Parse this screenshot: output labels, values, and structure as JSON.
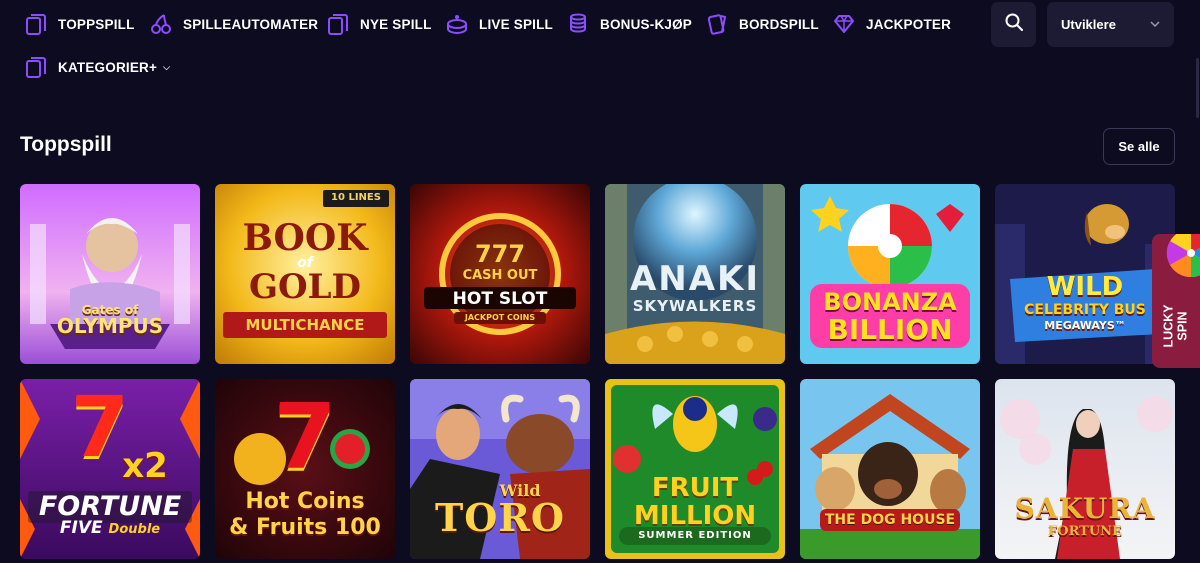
{
  "nav": {
    "items": [
      {
        "label": "TOPPSPILL",
        "icon": "cards-icon"
      },
      {
        "label": "SPILLEAUTOMATER",
        "icon": "cherries-icon"
      },
      {
        "label": "NYE SPILL",
        "icon": "cards-icon"
      },
      {
        "label": "LIVE SPILL",
        "icon": "live-table-icon"
      },
      {
        "label": "BONUS-KJØP",
        "icon": "coins-icon"
      },
      {
        "label": "BORDSPILL",
        "icon": "card-fan-icon"
      },
      {
        "label": "JACKPOTER",
        "icon": "diamond-icon"
      },
      {
        "label": "KATEGORIER+",
        "icon": "cards-icon"
      }
    ],
    "search_icon": "search-icon",
    "provider_select": "Utviklere",
    "accent": "#7b3ff2"
  },
  "section": {
    "title": "Toppspill",
    "see_all": "Se alle"
  },
  "games": [
    {
      "title": "Gates of Olympus",
      "art": [
        "Gates of",
        "OLYMPUS"
      ]
    },
    {
      "title": "Book of Gold Multichance",
      "art": [
        "10 LINES",
        "BOOK",
        "of",
        "GOLD",
        "MULTICHANCE"
      ]
    },
    {
      "title": "777 Cash Out Hot Slot",
      "art": [
        "777",
        "CASH OUT",
        "HOT SLOT",
        "JACKPOT COINS"
      ]
    },
    {
      "title": "Anaki Skywalkers",
      "art": [
        "ANAKI",
        "SKYWALKERS"
      ]
    },
    {
      "title": "Bonanza Billion",
      "art": [
        "BONANZA",
        "BILLION"
      ]
    },
    {
      "title": "Wild Celebrity Bus Megaways",
      "art": [
        "WILD",
        "CELEBRITY BUS",
        "MEGAWAYS™"
      ]
    },
    {
      "title": "Fortune Five Double",
      "art": [
        "7",
        "x2",
        "FORTUNE",
        "FIVE",
        "Double"
      ]
    },
    {
      "title": "Hot Coins & Fruits 100",
      "art": [
        "7",
        "Hot Coins",
        "& Fruits 100"
      ]
    },
    {
      "title": "Wild Toro",
      "art": [
        "Wild",
        "TORO"
      ]
    },
    {
      "title": "Fruit Million Summer Edition",
      "art": [
        "FRUIT",
        "MILLION",
        "SUMMER EDITION"
      ]
    },
    {
      "title": "The Dog House",
      "art": [
        "THE DOG HOUSE"
      ]
    },
    {
      "title": "Sakura Fortune",
      "art": [
        "SAKURA",
        "FORTUNE"
      ]
    }
  ],
  "lucky_spin": {
    "line1": "LUCKY",
    "line2": "SPIN"
  }
}
